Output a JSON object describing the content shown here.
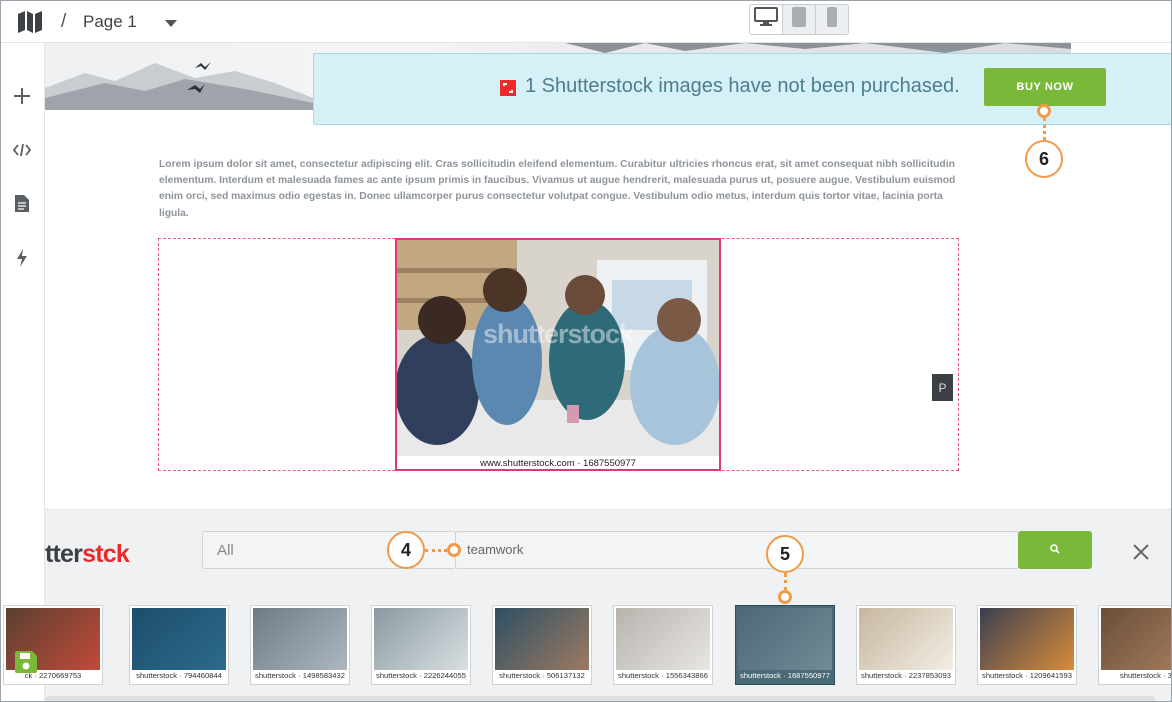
{
  "topbar": {
    "separator": "/",
    "page_label": "Page 1",
    "device_buttons": [
      "desktop-icon",
      "tablet-icon",
      "phone-icon"
    ],
    "active_device": "desktop"
  },
  "rail": {
    "items": [
      "plus-icon",
      "code-icon",
      "document-icon",
      "lightning-icon"
    ],
    "bottom": "save-icon"
  },
  "notification": {
    "text": "1 Shutterstock images have not been purchased.",
    "buy_label": "BUY NOW",
    "bg_color": "#d6f0f7",
    "button_color": "#7ab839"
  },
  "content": {
    "lorem": "Lorem ipsum dolor sit amet, consectetur adipiscing elit. Cras sollicitudin eleifend elementum. Curabitur ultricies rhoncus erat, sit amet consequat nibh sollicitudin elementum. Interdum et malesuada fames ac ante ipsum primis in faucibus. Vivamus ut augue hendrerit, malesuada purus ut, posuere augue. Vestibulum euismod enim orci, sed maximus odio egestas in. Donec ullamcorper purus consectetur volutpat congue. Vestibulum odio metus, interdum quis tortor vitae, lacinia porta ligula.",
    "image_watermark": "shutterstock",
    "image_caption": "www.shutterstock.com · 1687550977",
    "block_badge": "P"
  },
  "panel": {
    "logo_dark": "tter",
    "logo_red": "st",
    "logo_tail": "ck",
    "filter_value": "All",
    "search_value": "teamwork",
    "thumbnails": [
      {
        "id": "ck · 2270669753",
        "selected": false
      },
      {
        "id": "shutterstock · 794460844",
        "selected": false
      },
      {
        "id": "shutterstock · 1498583432",
        "selected": false
      },
      {
        "id": "shutterstock · 2226244055",
        "selected": false
      },
      {
        "id": "shutterstock · 506137132",
        "selected": false
      },
      {
        "id": "shutterstock · 1556343866",
        "selected": false
      },
      {
        "id": "shutterstock · 1687550977",
        "selected": true
      },
      {
        "id": "shutterstock · 2237853093",
        "selected": false
      },
      {
        "id": "shutterstock · 1209641593",
        "selected": false
      },
      {
        "id": "shutterstock · 34",
        "selected": false
      }
    ]
  },
  "callouts": [
    "4",
    "5",
    "6"
  ],
  "accent_color": "#f09a4a"
}
